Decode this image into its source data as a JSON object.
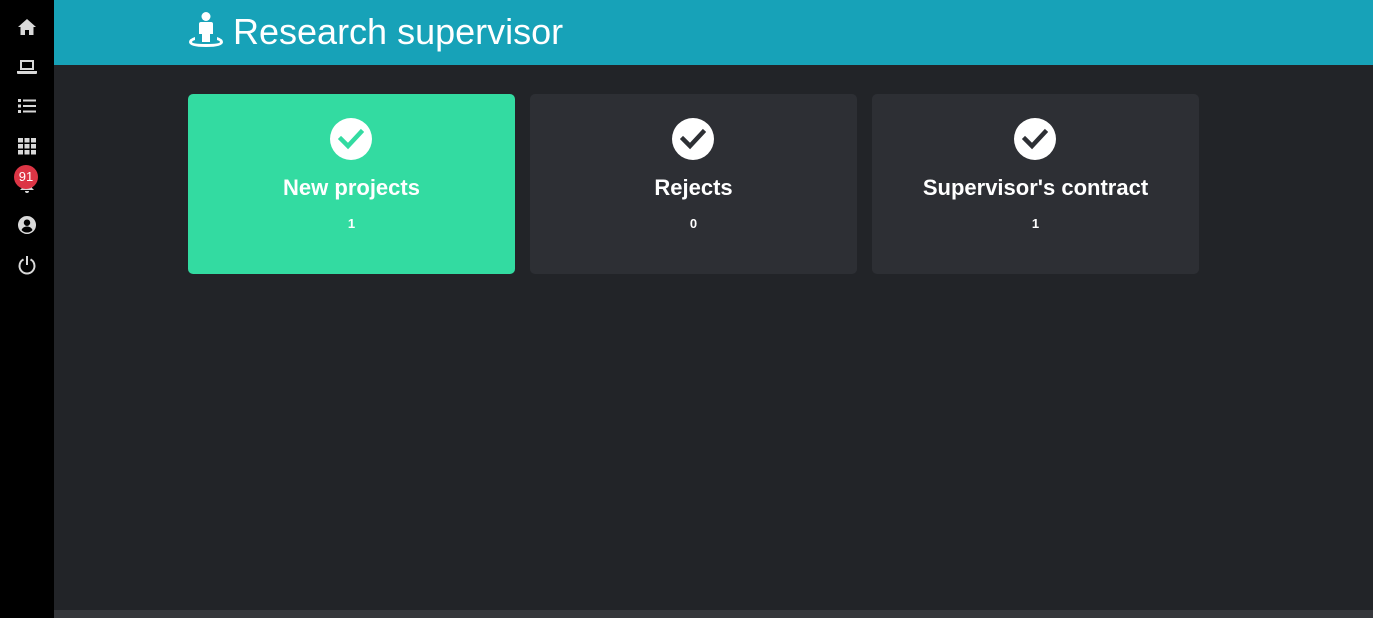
{
  "sidebar": {
    "items": [
      {
        "icon": "home-icon"
      },
      {
        "icon": "laptop-icon"
      },
      {
        "icon": "list-icon"
      },
      {
        "icon": "grid-icon"
      },
      {
        "icon": "bell-icon",
        "badge": "91"
      },
      {
        "icon": "user-circle-icon"
      },
      {
        "icon": "power-icon"
      }
    ]
  },
  "header": {
    "title": "Research supervisor",
    "icon": "user-pin-icon"
  },
  "cards": [
    {
      "title": "New projects",
      "count": "1",
      "icon": "check-circle-icon",
      "active": true
    },
    {
      "title": "Rejects",
      "count": "0",
      "icon": "check-circle-icon",
      "active": false
    },
    {
      "title": "Supervisor's contract",
      "count": "1",
      "icon": "check-circle-icon",
      "active": false
    }
  ],
  "colors": {
    "sidebar_bg": "#000000",
    "header_bg": "#17a2b8",
    "page_bg": "#222428",
    "card_bg": "#2d2f34",
    "card_active_bg": "#33dba1",
    "badge_bg": "#dc3545"
  }
}
